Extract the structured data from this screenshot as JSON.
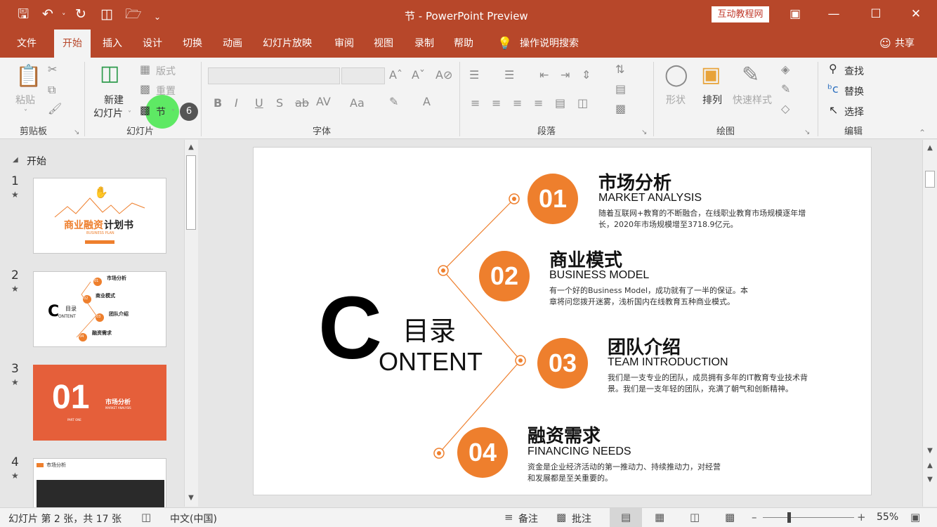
{
  "window": {
    "title": "节 - PowerPoint Preview",
    "brand": "互动教程网",
    "share": "共享"
  },
  "tabs": [
    "文件",
    "开始",
    "插入",
    "设计",
    "切换",
    "动画",
    "幻灯片放映",
    "审阅",
    "视图",
    "录制",
    "帮助",
    "操作说明搜索"
  ],
  "ribbon": {
    "clipboard": {
      "label": "剪贴板",
      "paste": "粘贴"
    },
    "slides": {
      "label": "幻灯片",
      "new_slide_1": "新建",
      "new_slide_2": "幻灯片",
      "layout": "版式",
      "reset": "重置",
      "section": "节",
      "badge": "6"
    },
    "font": {
      "label": "字体"
    },
    "paragraph": {
      "label": "段落"
    },
    "drawing": {
      "label": "绘图",
      "shapes": "形状",
      "arrange": "排列",
      "quick_styles": "快速样式"
    },
    "editing": {
      "label": "编辑",
      "find": "查找",
      "replace": "替换",
      "select": "选择"
    }
  },
  "panel": {
    "section_name": "开始",
    "slides": [
      {
        "num": "1",
        "title_orange": "商业融资",
        "title_black": "计划书",
        "sub": "BUSINESS PLAN"
      },
      {
        "num": "2",
        "c": "C",
        "mulu": "目录",
        "ontent": "ONTENT",
        "items": [
          {
            "n": "01",
            "t": "市场分析",
            "s": "MARKET ANALYSIS"
          },
          {
            "n": "02",
            "t": "商业模式",
            "s": "BUSINESS MODEL"
          },
          {
            "n": "03",
            "t": "团队介绍",
            "s": "TEAM INTRODUCTION"
          },
          {
            "n": "04",
            "t": "融资需求",
            "s": "FINANCING NEEDS"
          }
        ]
      },
      {
        "num": "3",
        "big": "01",
        "part": "PART ONE",
        "t": "市场分析",
        "s": "MARKET ANALYSIS"
      },
      {
        "num": "4",
        "t": "市场分析"
      }
    ]
  },
  "slide": {
    "c": "C",
    "mulu": "目录",
    "ontent": "ONTENT",
    "items": [
      {
        "num": "01",
        "title": "市场分析",
        "sub": "MARKET ANALYSIS",
        "desc": "随着互联网+教育的不断融合，在线职业教育市场规模逐年增长，2020年市场规模增至3718.9亿元。"
      },
      {
        "num": "02",
        "title": "商业模式",
        "sub": "BUSINESS MODEL",
        "desc": "有一个好的Business Model，成功就有了一半的保证。本章将问您拨开迷雾，浅析国内在线教育五种商业模式。"
      },
      {
        "num": "03",
        "title": "团队介绍",
        "sub": "TEAM INTRODUCTION",
        "desc": "我们是一支专业的团队，成员拥有多年的IT教育专业技术背景。我们是一支年轻的团队，充满了朝气和创新精神。"
      },
      {
        "num": "04",
        "title": "融资需求",
        "sub": "FINANCING NEEDS",
        "desc": "资金是企业经济活动的第一推动力、持续推动力，对经营和发展都是至关重要的。"
      }
    ],
    "accent": "#ee7f2d"
  },
  "status": {
    "slide_info": "幻灯片 第 2 张，共 17 张",
    "language": "中文(中国)",
    "notes": "备注",
    "comments": "批注",
    "zoom": "55%"
  },
  "colors": {
    "titlebar": "#b7472a",
    "accent": "#ee7f2d"
  }
}
